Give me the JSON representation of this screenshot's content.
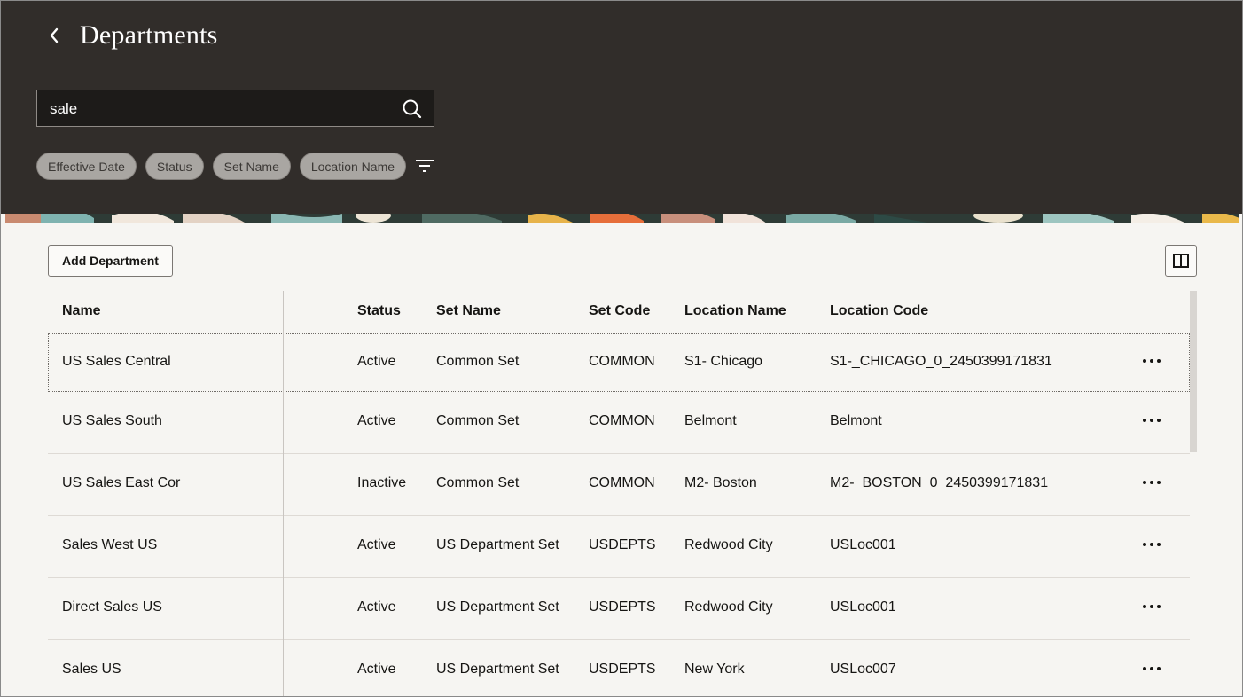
{
  "header": {
    "title": "Departments",
    "back_icon": "chevron-left-icon"
  },
  "search": {
    "value": "sale",
    "placeholder": "",
    "icon": "search-icon"
  },
  "filters": {
    "chips": [
      "Effective Date",
      "Status",
      "Set Name",
      "Location Name"
    ],
    "filter_icon": "filter-icon"
  },
  "toolbar": {
    "add_label": "Add Department",
    "panel_icon": "split-panel-icon"
  },
  "table": {
    "columns": [
      "Name",
      "Status",
      "Set Name",
      "Set Code",
      "Location Name",
      "Location Code"
    ],
    "rows": [
      {
        "name": "US Sales Central",
        "status": "Active",
        "set_name": "Common Set",
        "set_code": "COMMON",
        "location_name": "S1- Chicago",
        "location_code": "S1-_CHICAGO_0_2450399171831"
      },
      {
        "name": "US Sales South",
        "status": "Active",
        "set_name": "Common Set",
        "set_code": "COMMON",
        "location_name": "Belmont",
        "location_code": "Belmont"
      },
      {
        "name": "US Sales East Cor",
        "status": "Inactive",
        "set_name": "Common Set",
        "set_code": "COMMON",
        "location_name": "M2- Boston",
        "location_code": "M2-_BOSTON_0_2450399171831"
      },
      {
        "name": "Sales West US",
        "status": "Active",
        "set_name": "US Department Set",
        "set_code": "USDEPTS",
        "location_name": "Redwood City",
        "location_code": "USLoc001"
      },
      {
        "name": "Direct Sales US",
        "status": "Active",
        "set_name": "US Department Set",
        "set_code": "USDEPTS",
        "location_name": "Redwood City",
        "location_code": "USLoc001"
      },
      {
        "name": "Sales US",
        "status": "Active",
        "set_name": "US Department Set",
        "set_code": "USDEPTS",
        "location_name": "New York",
        "location_code": "USLoc007"
      }
    ],
    "row_action_icon": "more-actions-icon"
  },
  "colors": {
    "header_bg": "#312d2a",
    "page_bg": "#f6f5f2",
    "chip_bg": "#a9a6a2"
  }
}
